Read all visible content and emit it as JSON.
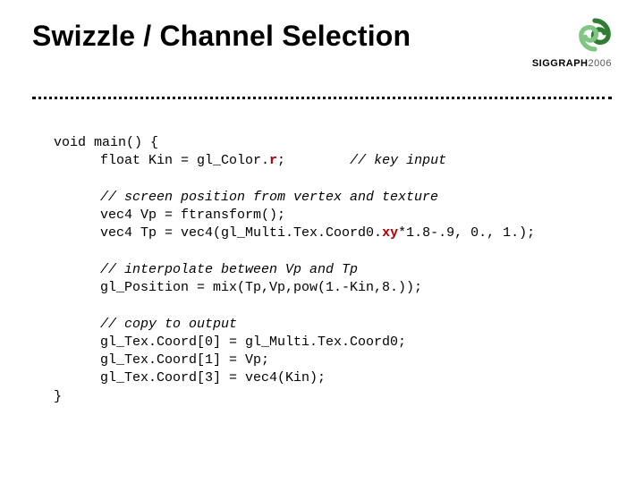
{
  "title": "Swizzle / Channel Selection",
  "logo": {
    "brand_bold": "SIGGRAPH",
    "brand_light": "2006"
  },
  "code": {
    "l1_a": "void main() {",
    "l2_a": "float Kin = gl_Color.",
    "l2_hl": "r",
    "l2_b": ";",
    "l2_c": "// key input",
    "l3_a": "// screen position from vertex and texture",
    "l4_a": "vec4 Vp = ftransform();",
    "l5_a": "vec4 Tp = vec4(gl_Multi.Tex.Coord0.",
    "l5_hl": "xy",
    "l5_b": "*1.8-.9, 0., 1.);",
    "l6_a": "// interpolate between Vp and Tp",
    "l7_a": "gl_Position = mix(Tp,Vp,pow(1.-Kin,8.));",
    "l8_a": "// copy to output",
    "l9_a": "gl_Tex.Coord[0] = gl_Multi.Tex.Coord0;",
    "l10_a": "gl_Tex.Coord[1] = Vp;",
    "l11_a": "gl_Tex.Coord[3] = vec4(Kin);",
    "l12_a": "}"
  }
}
